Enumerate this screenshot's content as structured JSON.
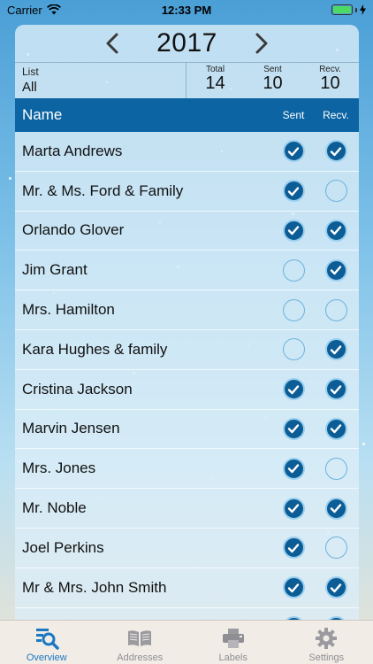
{
  "status_bar": {
    "carrier": "Carrier",
    "time": "12:33 PM"
  },
  "year_nav": {
    "year": "2017",
    "prev_icon": "chevron-left-icon",
    "next_icon": "chevron-right-icon"
  },
  "summary": {
    "list_label": "List",
    "list_value": "All",
    "total_label": "Total",
    "total_value": "14",
    "sent_label": "Sent",
    "sent_value": "10",
    "recv_label": "Recv.",
    "recv_value": "10"
  },
  "table": {
    "name_header": "Name",
    "sent_header": "Sent",
    "recv_header": "Recv.",
    "rows": [
      {
        "name": "Marta Andrews",
        "sent": true,
        "recv": true
      },
      {
        "name": "Mr. & Ms. Ford & Family",
        "sent": true,
        "recv": false
      },
      {
        "name": "Orlando Glover",
        "sent": true,
        "recv": true
      },
      {
        "name": "Jim Grant",
        "sent": false,
        "recv": true
      },
      {
        "name": "Mrs. Hamilton",
        "sent": false,
        "recv": false
      },
      {
        "name": "Kara Hughes & family",
        "sent": false,
        "recv": true
      },
      {
        "name": "Cristina Jackson",
        "sent": true,
        "recv": true
      },
      {
        "name": "Marvin Jensen",
        "sent": true,
        "recv": true
      },
      {
        "name": "Mrs. Jones",
        "sent": true,
        "recv": false
      },
      {
        "name": "Mr. Noble",
        "sent": true,
        "recv": true
      },
      {
        "name": "Joel Perkins",
        "sent": true,
        "recv": false
      },
      {
        "name": "Mr & Mrs. John Smith",
        "sent": true,
        "recv": true
      },
      {
        "name": "",
        "sent": true,
        "recv": true
      }
    ]
  },
  "tabs": [
    {
      "label": "Overview",
      "icon": "overview-search-icon",
      "active": true
    },
    {
      "label": "Addresses",
      "icon": "address-book-icon",
      "active": false
    },
    {
      "label": "Labels",
      "icon": "printer-icon",
      "active": false
    },
    {
      "label": "Settings",
      "icon": "gear-icon",
      "active": false
    }
  ],
  "colors": {
    "header_blue": "#0c64a3",
    "check_fill": "#0c5d96",
    "active_tab": "#1c78c2"
  }
}
